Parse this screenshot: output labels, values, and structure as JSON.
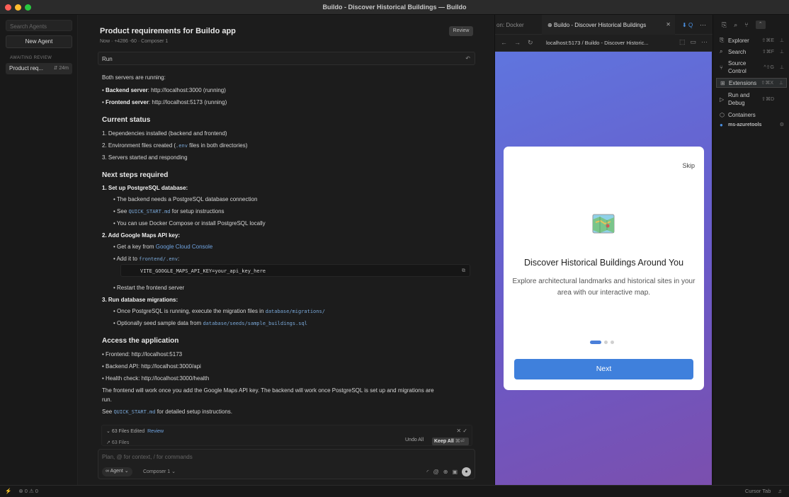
{
  "window": {
    "title": "Buildo - Discover Historical Buildings — Buildo"
  },
  "agents_sidebar": {
    "search_placeholder": "Search Agents",
    "new_agent": "New Agent",
    "section_label": "AWAITING REVIEW",
    "items": [
      {
        "label": "Product req...",
        "meta": "24m"
      }
    ]
  },
  "chat": {
    "title": "Product requirements for Buildo app",
    "subtitle": "Now · +4286 -60 · Composer 1",
    "review_button": "Review",
    "run_label": "Run",
    "lines": {
      "servers_intro": "Both servers are running:",
      "backend_label": "Backend server",
      "backend_value": ": http://localhost:3000 (running)",
      "frontend_label": "Frontend server",
      "frontend_value": ": http://localhost:5173 (running)",
      "h_status": "Current status",
      "status_1": "1. Dependencies installed (backend and frontend)",
      "status_2a": "2. Environment files created (",
      "status_2code": ".env",
      "status_2b": " files in both directories)",
      "status_3": "3. Servers started and responding",
      "h_next": "Next steps required",
      "step1": "1. Set up PostgreSQL database:",
      "step1_a": "The backend needs a PostgreSQL database connection",
      "step1_b_pre": "See ",
      "step1_b_code": "QUICK_START.md",
      "step1_b_post": " for setup instructions",
      "step1_c": "You can use Docker Compose or install PostgreSQL locally",
      "step2": "2. Add Google Maps API key:",
      "step2_a_pre": "Get a key from ",
      "step2_a_link": "Google Cloud Console",
      "step2_b_pre": "Add it to ",
      "step2_b_code": "frontend/.env",
      "step2_b_post": ":",
      "code_block": "VITE_GOOGLE_MAPS_API_KEY=your_api_key_here",
      "step2_c": "Restart the frontend server",
      "step3": "3. Run database migrations:",
      "step3_a_pre": "Once PostgreSQL is running, execute the migration files in ",
      "step3_a_code": "database/migrations/",
      "step3_b_pre": "Optionally seed sample data from ",
      "step3_b_code": "database/seeds/sample_buildings.sql",
      "h_access": "Access the application",
      "access_1": "Frontend: http://localhost:5173",
      "access_2": "Backend API: http://localhost:3000/api",
      "access_3": "Health check: http://localhost:3000/health",
      "closing_1": "The frontend will work once you add the Google Maps API key. The backend will work once PostgreSQL is set up and migrations are",
      "closing_2": "run.",
      "see_pre": "See ",
      "see_code": "QUICK_START.md",
      "see_post": " for detailed setup instructions."
    },
    "edits": {
      "files_edited": "63 Files Edited",
      "review": "Review",
      "files_count": "63 Files",
      "undo_all": "Undo All",
      "keep_all": "Keep All",
      "keep_all_kbd": "⌘⏎"
    },
    "composer": {
      "placeholder": "Plan, @ for context, / for commands",
      "mode": "Agent",
      "model": "Composer 1"
    }
  },
  "browser": {
    "tabs": [
      {
        "label": "on: Docker"
      },
      {
        "label": "Buildo - Discover Historical Buildings"
      },
      {
        "label": "Q"
      }
    ],
    "url": "localhost:5173 / Buildo - Discover Historic...",
    "page": {
      "skip": "Skip",
      "title": "Discover Historical Buildings Around You",
      "description": "Explore architectural landmarks and historical sites in your area with our interactive map.",
      "next": "Next",
      "slide_index": 1,
      "slide_count": 3
    }
  },
  "activity_sidebar": {
    "items": [
      {
        "label": "Explorer",
        "kbd": "⇧⌘E"
      },
      {
        "label": "Search",
        "kbd": "⇧⌘F"
      },
      {
        "label": "Source Control",
        "kbd": "^⇧G"
      },
      {
        "label": "Extensions",
        "kbd": "⇧⌘X"
      },
      {
        "label": "Run and Debug",
        "kbd": "⇧⌘D"
      },
      {
        "label": "Containers"
      },
      {
        "label": "ms-azuretools"
      }
    ]
  },
  "statusbar": {
    "problems": "0 ⚠ 0",
    "right": "Cursor Tab"
  },
  "colors": {
    "accent": "#3f80dc",
    "gradient_start": "#5f75de",
    "gradient_end": "#7b4fae"
  }
}
